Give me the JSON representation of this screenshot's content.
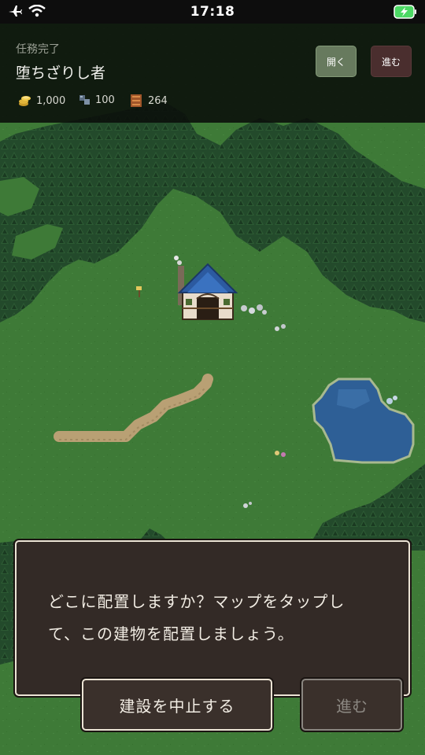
{
  "status_bar": {
    "time": "17:18",
    "icons": [
      "airplane-icon",
      "wifi-icon",
      "battery-charging-icon"
    ]
  },
  "hud": {
    "subtitle": "任務完了",
    "title": "堕ちざりし者",
    "resources": [
      {
        "icon": "gold-coins-icon",
        "value": "1,000"
      },
      {
        "icon": "stone-ore-icon",
        "value": "100"
      },
      {
        "icon": "wood-planks-icon",
        "value": "264"
      }
    ],
    "open_button": "開く",
    "next_button": "進む"
  },
  "dialog": {
    "message_line1": "どこに配置しますか？マップをタップし",
    "message_line2": "て、この建物を配置しましょう。",
    "cancel_button": "建設を中止する",
    "next_button": "進む"
  },
  "colors": {
    "grass": "#3e7a37",
    "forest": "#234a2b",
    "lake": "#2e5f96",
    "path": "#b9a074",
    "roof": "#2c5aa0",
    "dialog_bg": "#332a26",
    "dialog_border": "#ece4d5"
  }
}
